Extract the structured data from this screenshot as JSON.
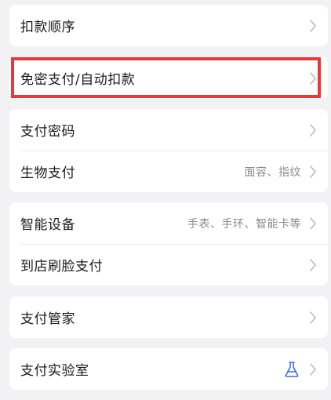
{
  "accent_color": "#3b6fe0",
  "highlight_color": "#e8383b",
  "sections": [
    {
      "items": [
        {
          "label": "扣款顺序",
          "value": "",
          "icon": "chevron-right-icon"
        }
      ]
    },
    {
      "items": [
        {
          "label": "免密支付/自动扣款",
          "value": "",
          "icon": "chevron-right-icon"
        }
      ]
    },
    {
      "items": [
        {
          "label": "支付密码",
          "value": "",
          "icon": "chevron-right-icon"
        },
        {
          "label": "生物支付",
          "value": "面容、指纹",
          "icon": "chevron-right-icon"
        }
      ]
    },
    {
      "items": [
        {
          "label": "智能设备",
          "value": "手表、手环、智能卡等",
          "icon": "chevron-right-icon"
        },
        {
          "label": "到店刷脸支付",
          "value": "",
          "icon": "chevron-right-icon"
        }
      ]
    },
    {
      "items": [
        {
          "label": "支付管家",
          "value": "",
          "icon": "chevron-right-icon"
        }
      ]
    },
    {
      "items": [
        {
          "label": "支付实验室",
          "value": "",
          "icon": "chevron-right-icon",
          "badge_icon": "flask-icon"
        }
      ]
    }
  ]
}
